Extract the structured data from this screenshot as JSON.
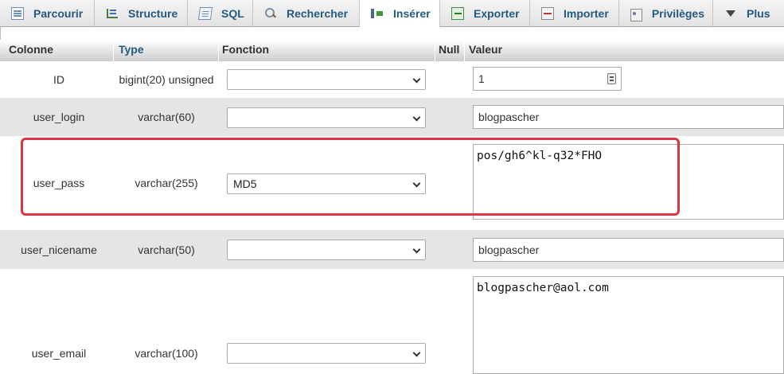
{
  "tabs": [
    {
      "label": "Parcourir",
      "icon": "browse-icon",
      "active": false
    },
    {
      "label": "Structure",
      "icon": "structure-icon",
      "active": false
    },
    {
      "label": "SQL",
      "icon": "sql-icon",
      "active": false
    },
    {
      "label": "Rechercher",
      "icon": "search-icon",
      "active": false
    },
    {
      "label": "Insérer",
      "icon": "insert-icon",
      "active": true
    },
    {
      "label": "Exporter",
      "icon": "export-icon",
      "active": false
    },
    {
      "label": "Importer",
      "icon": "import-icon",
      "active": false
    },
    {
      "label": "Privilèges",
      "icon": "privileges-icon",
      "active": false
    },
    {
      "label": "Plus",
      "icon": "caret-down-icon",
      "active": false
    }
  ],
  "table": {
    "headers": {
      "column": "Colonne",
      "type": "Type",
      "function": "Fonction",
      "null": "Null",
      "value": "Valeur"
    },
    "rows": [
      {
        "column": "ID",
        "type": "bigint(20) unsigned",
        "function": "",
        "value": "1"
      },
      {
        "column": "user_login",
        "type": "varchar(60)",
        "function": "",
        "value": "blogpascher"
      },
      {
        "column": "user_pass",
        "type": "varchar(255)",
        "function": "MD5",
        "value": "pos/gh6^kl-q32*FHO"
      },
      {
        "column": "user_nicename",
        "type": "varchar(50)",
        "function": "",
        "value": "blogpascher"
      },
      {
        "column": "user_email",
        "type": "varchar(100)",
        "function": "",
        "value": "blogpascher@aol.com"
      }
    ]
  },
  "colors": {
    "accent": "#235a81",
    "highlight": "#dc3545",
    "row_alt": "#e5e5e5"
  }
}
